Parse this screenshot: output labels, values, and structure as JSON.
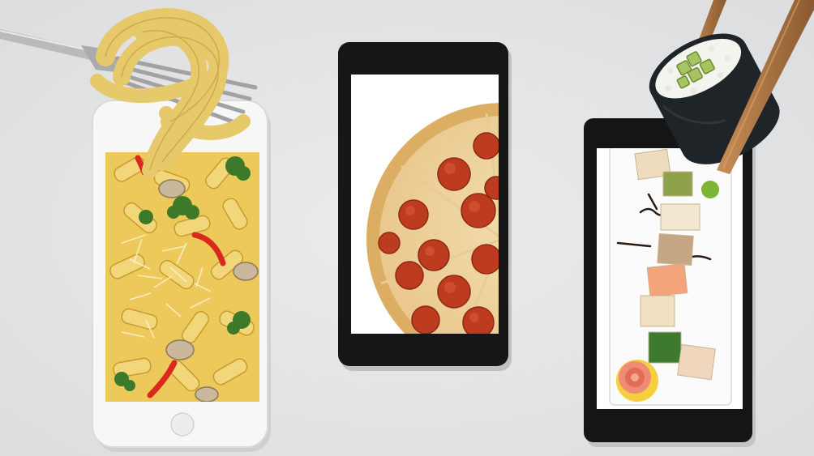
{
  "scene": {
    "background": "#e6e7e8",
    "phones": [
      {
        "name": "white-smartphone",
        "content": "pasta-dish",
        "frame": "#f4f4f4"
      },
      {
        "name": "black-smartphone",
        "content": "pepperoni-pizza",
        "frame": "#151515"
      },
      {
        "name": "black-smartphone",
        "content": "sushi-platter",
        "frame": "#151515"
      }
    ],
    "props": [
      "fork-with-tagliatelle",
      "chopsticks-with-sushi-roll"
    ],
    "colors": {
      "pasta": "#e9c44f",
      "pizza_crust": "#e2b26a",
      "pepperoni": "#b93a1e",
      "cheese": "#f1d9a3",
      "nori": "#1d2226",
      "rice": "#f4f4ef",
      "cucumber": "#a7c46a",
      "chopstick": "#b27a45"
    }
  }
}
